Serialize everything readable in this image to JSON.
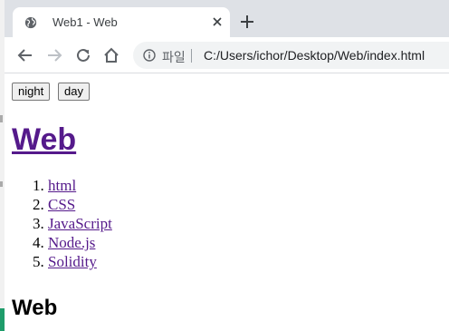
{
  "browser": {
    "tab": {
      "title": "Web1 - Web",
      "favicon": "globe-icon",
      "close_icon": "close-icon"
    },
    "new_tab_icon": "plus-icon",
    "toolbar": {
      "back_icon": "back-arrow-icon",
      "forward_icon": "forward-arrow-icon",
      "reload_icon": "reload-icon",
      "home_icon": "home-icon"
    },
    "omnibox": {
      "info_icon": "info-icon",
      "scheme_label": "파일",
      "url": "C:/Users/ichor/Desktop/Web/index.html"
    }
  },
  "page": {
    "buttons": {
      "night": "night",
      "day": "day"
    },
    "title": "Web",
    "nav": [
      {
        "label": "html"
      },
      {
        "label": "CSS"
      },
      {
        "label": "JavaScript"
      },
      {
        "label": "Node.js"
      },
      {
        "label": "Solidity"
      }
    ],
    "section_heading": "Web",
    "link_color": "#551a8b"
  }
}
